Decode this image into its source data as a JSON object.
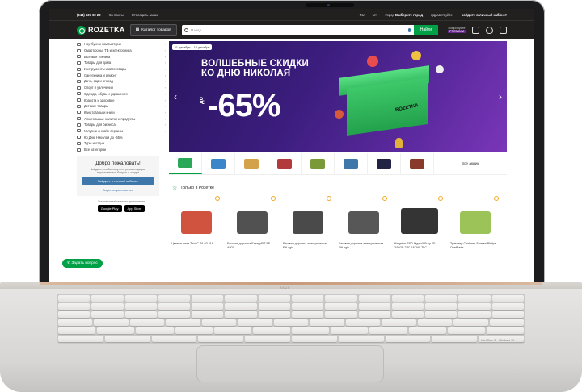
{
  "topbar": {
    "phone": "(044) 537 02 22",
    "contacts": "Контакты",
    "track": "Отследить заказ",
    "lang_ru": "RU",
    "lang_ua": "UA",
    "city_label": "Город",
    "city_value": "Выберите город",
    "greeting": "Здравствуйте,",
    "login": "войдите в личный кабинет"
  },
  "header": {
    "logo": "ROZETKA",
    "catalog": "Каталог товаров",
    "search_placeholder": "Я ищу...",
    "find": "Найти",
    "premium_line1": "Попробуйте",
    "premium_tag": "PREMIUM"
  },
  "sidebar": {
    "items": [
      "Ноутбуки и компьютеры",
      "Смартфоны, ТВ и электроника",
      "Бытовая техника",
      "Товары для дома",
      "Инструменты и автотовары",
      "Сантехника и ремонт",
      "Дача, сад и огород",
      "Спорт и увлечения",
      "Одежда, обувь и украшения",
      "Красота и здоровье",
      "Детские товары",
      "Канцтовары и книги",
      "Алкогольные напитки и продукты",
      "Товары для бизнеса",
      "Услуги и онлайн-сервисы",
      "Ко Дню Николая до -65%",
      "Туры и отдых",
      "Все категории"
    ],
    "welcome_title": "Добро пожаловать!",
    "welcome_text": "Войдите, чтобы получить рекомендации, персональные бонусы и скидки",
    "login_button": "Войдите в личный кабинет",
    "register": "Зарегистрироваться",
    "apps_text": "Устанавливайте наши приложения",
    "google": "Google Play",
    "apple": "App Store",
    "ask": "Задать вопрос"
  },
  "banner": {
    "date": "11 декабря – 19 декабря",
    "line1": "ВОЛШЕБНЫЕ СКИДКИ",
    "line2": "КО ДНЮ НИКОЛАЯ",
    "prefix": "до",
    "discount": "-65%",
    "box_label": "ROZETKA"
  },
  "thumbs": {
    "all_label": "Все акции",
    "colors": [
      "#2aa857",
      "#3a86c8",
      "#d4a24a",
      "#b33a3a",
      "#7a9a3a",
      "#3e77aa",
      "#222244",
      "#8a3a2a"
    ]
  },
  "section": {
    "title": "Только в Розетке"
  },
  "products": [
    {
      "name": "Цепная пила TexAC TA-03-116"
    },
    {
      "name": "Беговая дорожка EnergyFIT EF-A507"
    },
    {
      "name": "Беговая дорожка электрическая FitLogic"
    },
    {
      "name": "Беговая дорожка электрическая FitLogic"
    },
    {
      "name": "Kingston SSD HyperX Fury 3D 240GB 2.5\" SATAIII TLC"
    },
    {
      "name": "Триммер-Стайлер-Бритва Philips OneBlade"
    }
  ],
  "laptop": {
    "hinge_text": "ASUS",
    "sticker": "Intel Core i5 · Windows 10"
  }
}
